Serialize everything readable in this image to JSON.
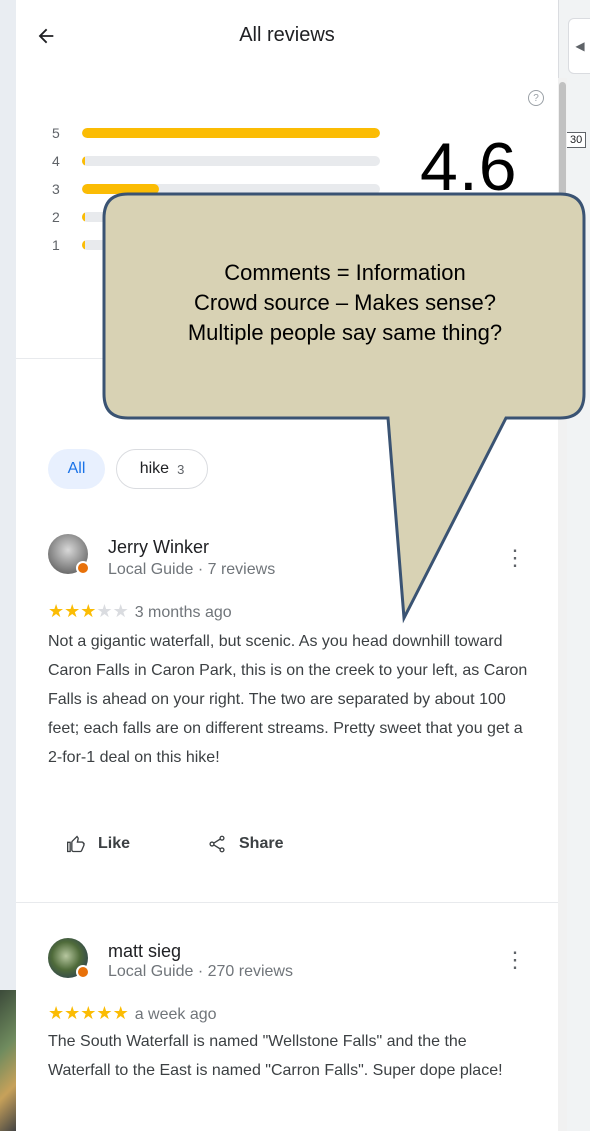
{
  "header": {
    "title": "All reviews"
  },
  "map": {
    "collapse_icon": "chevron-left-icon",
    "route_label": "30"
  },
  "summary": {
    "rows": [
      {
        "stars": "5",
        "fraction": 1.0
      },
      {
        "stars": "4",
        "fraction": 0.01
      },
      {
        "stars": "3",
        "fraction": 0.26
      },
      {
        "stars": "2",
        "fraction": 0.01
      },
      {
        "stars": "1",
        "fraction": 0.01
      }
    ],
    "average": "4.6",
    "help_icon": "help-icon"
  },
  "callout": {
    "lines": [
      "Comments = Information",
      "Crowd source – Makes sense?",
      "Multiple people say same thing?"
    ],
    "fill": "#d8d2b4",
    "border": "#3a5373"
  },
  "chips": [
    {
      "label": "All",
      "count": ""
    },
    {
      "label": "hike",
      "count": "3"
    }
  ],
  "reviews": [
    {
      "name": "Jerry Winker",
      "meta": "Local Guide · 7 reviews",
      "rating": 3,
      "time": "3 months ago",
      "text": "Not a gigantic waterfall, but scenic. As you head downhill toward Caron Falls in Caron Park, this is on the creek to your left, as Caron Falls is ahead on your right. The two are separated by about 100 feet; each falls are on different streams. Pretty sweet that you get a 2-for-1 deal on this hike!"
    },
    {
      "name": "matt sieg",
      "meta": "Local Guide · 270 reviews",
      "rating": 5,
      "time": "a week ago",
      "text": "The South Waterfall is named \"Wellstone Falls\" and the the Waterfall to the East is named \"Carron Falls\". Super dope place!"
    }
  ],
  "actions": {
    "like": "Like",
    "share": "Share"
  },
  "colors": {
    "star": "#fbbc04",
    "chip_active_bg": "#e8f0fe",
    "chip_active_text": "#1a73e8",
    "badge": "#e8710a"
  }
}
